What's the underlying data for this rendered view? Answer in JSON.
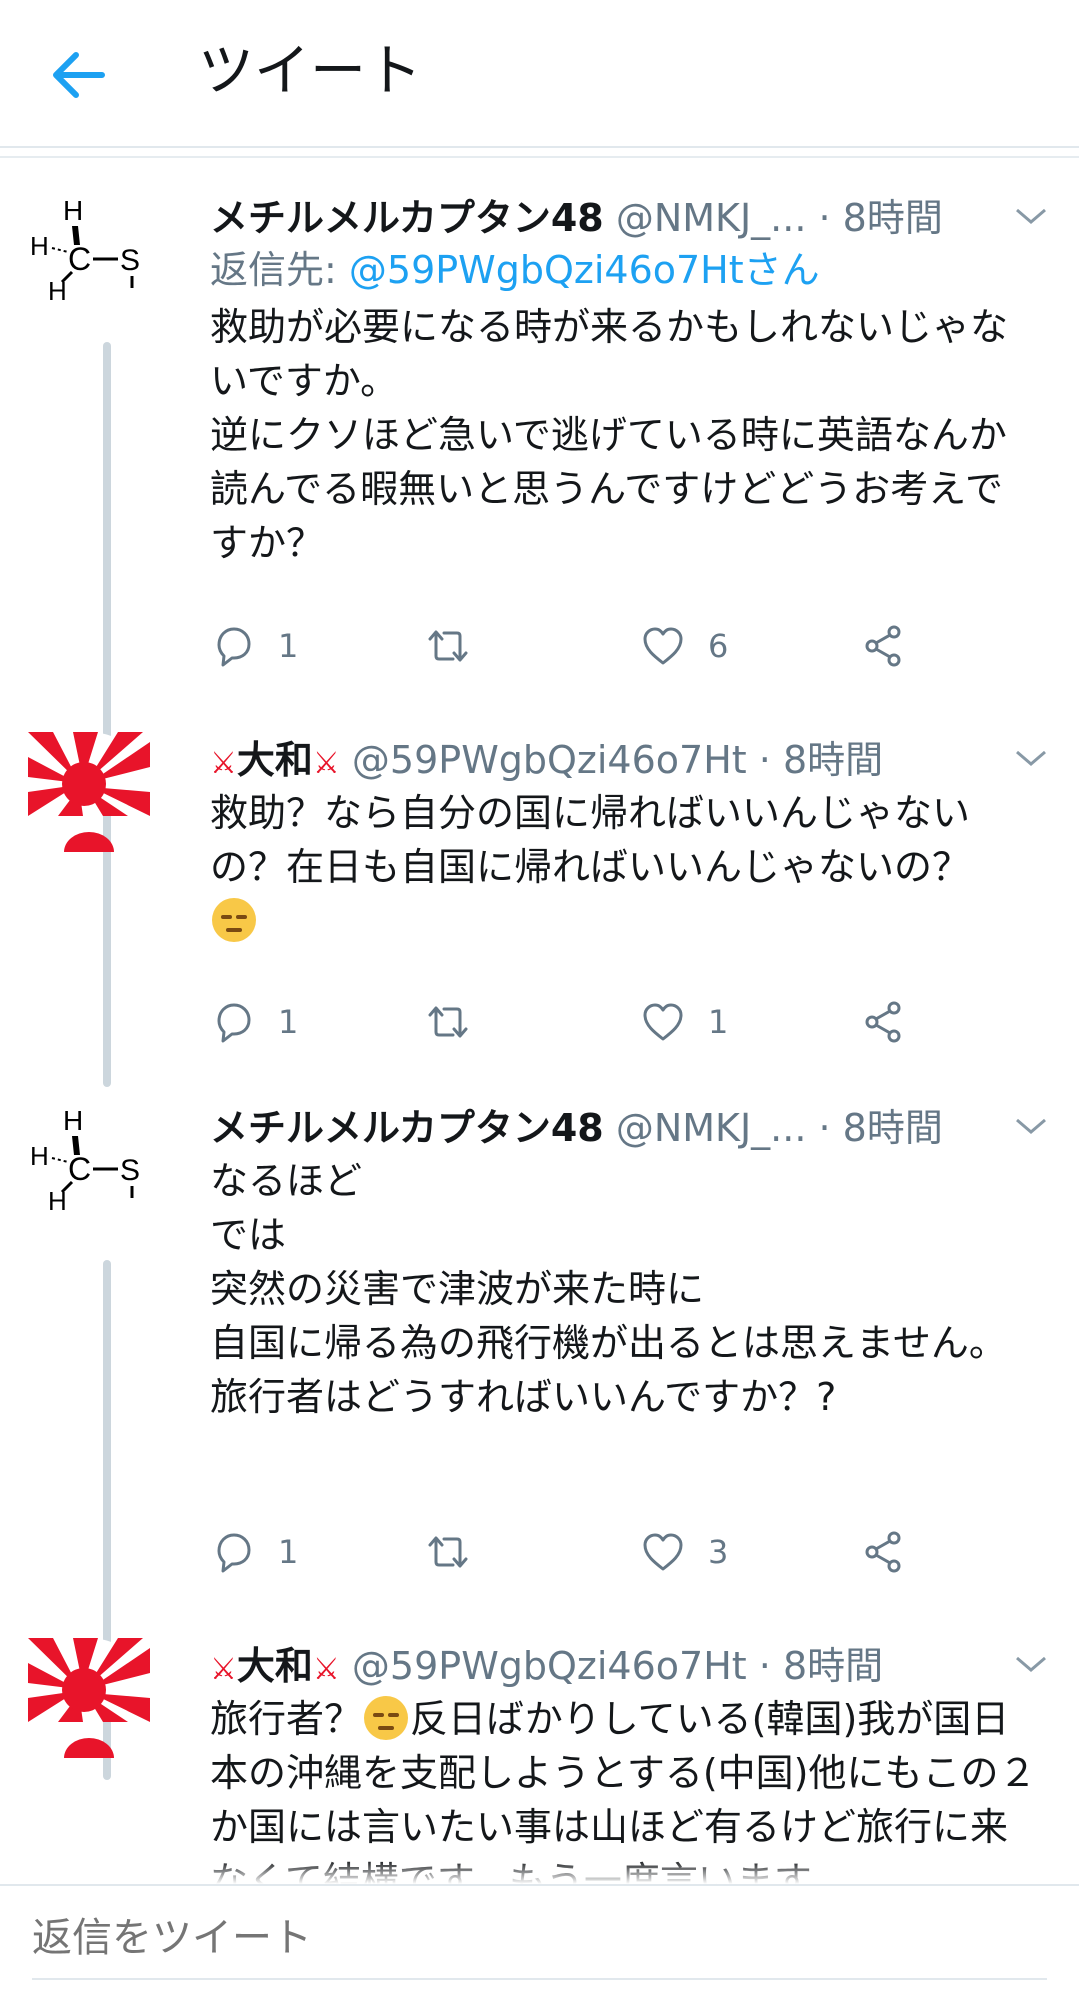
{
  "header": {
    "title": "ツイート"
  },
  "tweets": [
    {
      "name": "メチルメルカプタン48",
      "handle": "@NMKJ_...",
      "time": "· 8時間",
      "reply_to_label": "返信先: ",
      "reply_to_handle": "@59PWgbQzi46o7Htさん",
      "text": "救助が必要になる時が来るかもしれないじゃないですか。\n逆にクソほど急いで逃げている時に英語なんか読んでる暇無いと思うんですけどどうお考えですか？",
      "replies": "1",
      "retweets": "",
      "likes": "6"
    },
    {
      "name": "大和",
      "handle": "@59PWgbQzi46o7Ht",
      "time": "· 8時間",
      "text_a": "救助？なら自分の国に帰ればいいんじゃないの？在日も自国に帰ればいいんじゃないの？",
      "replies": "1",
      "retweets": "",
      "likes": "1"
    },
    {
      "name": "メチルメルカプタン48",
      "handle": "@NMKJ_...",
      "time": "· 8時間",
      "text": "なるほど\nでは\n突然の災害で津波が来た時に\n自国に帰る為の飛行機が出るとは思えません。\n旅行者はどうすればいいんですか？?",
      "replies": "1",
      "retweets": "",
      "likes": "3"
    },
    {
      "name": "大和",
      "handle": "@59PWgbQzi46o7Ht",
      "time": "· 8時間",
      "text_a": "旅行者？",
      "text_b": "反日ばかりしている(韓国)我が国日本の沖縄を支配しようとする(中国)他にもこの２か国には言いたい事は山ほど有るけど旅行に来なくて結構です。もう一度言います"
    }
  ],
  "reply_bar": {
    "placeholder": "返信をツイート"
  },
  "colors": {
    "accent": "#1da1f2",
    "secondary": "#657786",
    "divider": "#e1e8ed",
    "flag_red": "#e8142a"
  }
}
